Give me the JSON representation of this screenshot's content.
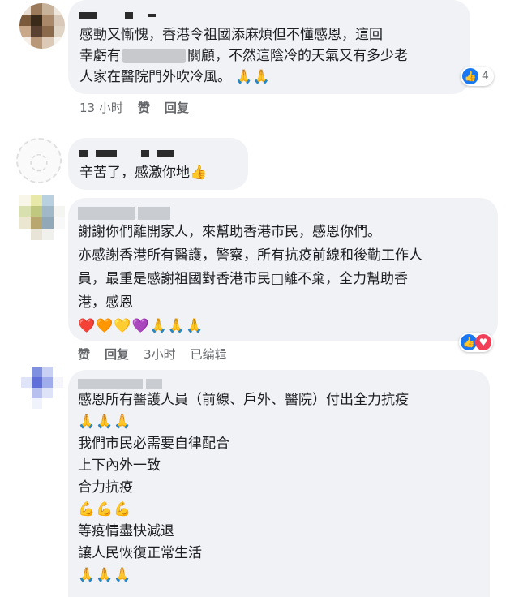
{
  "comments": [
    {
      "lines": [
        "感動又慚愧，香港令祖國添麻煩但不懂感恩，這回",
        "幸虧有",
        "關顧，不然這陰冷的天氣又有多少老",
        "人家在醫院門外吹冷風。 🙏🙏"
      ],
      "time": "13 小时",
      "like": "赞",
      "reply": "回复",
      "reaction_count": "4"
    },
    {
      "lines": [
        "辛苦了，感激你地👍"
      ]
    },
    {
      "lines": [
        "謝謝你們離開家人，來幫助香港市民，感恩你們。",
        "亦感謝香港所有醫護，警察，所有抗疫前線和後勤工作人",
        "員，最重是感謝祖國對香港市民□離不棄，全力幫助香",
        "港，感恩",
        "❤️🧡💛💜🙏🙏🙏"
      ],
      "like": "赞",
      "reply": "回复",
      "time": "3小时",
      "edited": "已编辑"
    },
    {
      "lines": [
        "感恩所有醫護人員（前線、戶外、醫院）付出全力抗疫",
        "🙏🙏🙏",
        "我們市民必需要自律配合",
        "上下內外一致",
        "合力抗疫",
        "💪💪💪",
        "等疫情盡快減退",
        "讓人民恢復正常生活",
        "🙏🙏🙏"
      ]
    }
  ],
  "icons": {
    "like": "thumbs-up-icon",
    "love": "heart-icon"
  },
  "colors": {
    "bubble": "#f0f2f5",
    "like_blue": "#1877f2",
    "love_red": "#f33e58",
    "meta_gray": "#65676b"
  }
}
